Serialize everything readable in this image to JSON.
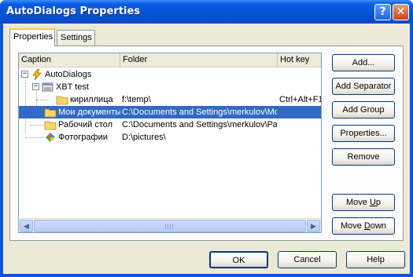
{
  "window": {
    "title": "AutoDialogs Properties",
    "help_glyph": "?",
    "close_glyph": "✕"
  },
  "tabs": [
    {
      "label": "Properties",
      "active": true
    },
    {
      "label": "Settings",
      "active": false
    }
  ],
  "list": {
    "columns": [
      "Caption",
      "Folder",
      "Hot key"
    ],
    "rows": [
      {
        "caption": "AutoDialogs",
        "folder": "",
        "hotkey": "",
        "level": 0,
        "expander": "−",
        "icon": "lightning-icon"
      },
      {
        "caption": "XBT test",
        "folder": "",
        "hotkey": "",
        "level": 1,
        "expander": "−",
        "icon": "group-icon"
      },
      {
        "caption": "кириллица",
        "folder": "f:\\temp\\",
        "hotkey": "Ctrl+Alt+F1",
        "level": 2,
        "expander": "",
        "icon": "folder-icon"
      },
      {
        "caption": "Мои документы",
        "folder": "C:\\Documents and Settings\\merkulov\\Мои документы",
        "hotkey": "",
        "level": 1,
        "expander": "",
        "icon": "folder-icon",
        "selected": true
      },
      {
        "caption": "Рабочий стол",
        "folder": "C:\\Documents and Settings\\merkulov\\Рабочий стол",
        "hotkey": "",
        "level": 1,
        "expander": "",
        "icon": "folder-icon"
      },
      {
        "caption": "Фотографии",
        "folder": "D:\\pictures\\",
        "hotkey": "",
        "level": 1,
        "expander": "",
        "icon": "pictures-icon"
      }
    ]
  },
  "side_buttons": {
    "add": "Add...",
    "add_separator": "Add Separator",
    "add_group": "Add Group",
    "properties": "Properties...",
    "remove": "Remove",
    "move_up_pre": "Move ",
    "move_up_u": "U",
    "move_up_post": "p",
    "move_down_pre": "Move ",
    "move_down_u": "D",
    "move_down_post": "own"
  },
  "bottom_buttons": {
    "ok": "OK",
    "cancel": "Cancel",
    "help": "Help"
  },
  "colors": {
    "selection": "#316ac5",
    "titlebar": "#0553d6",
    "face": "#ece9d8",
    "tab_highlight": "#ffc83c"
  }
}
